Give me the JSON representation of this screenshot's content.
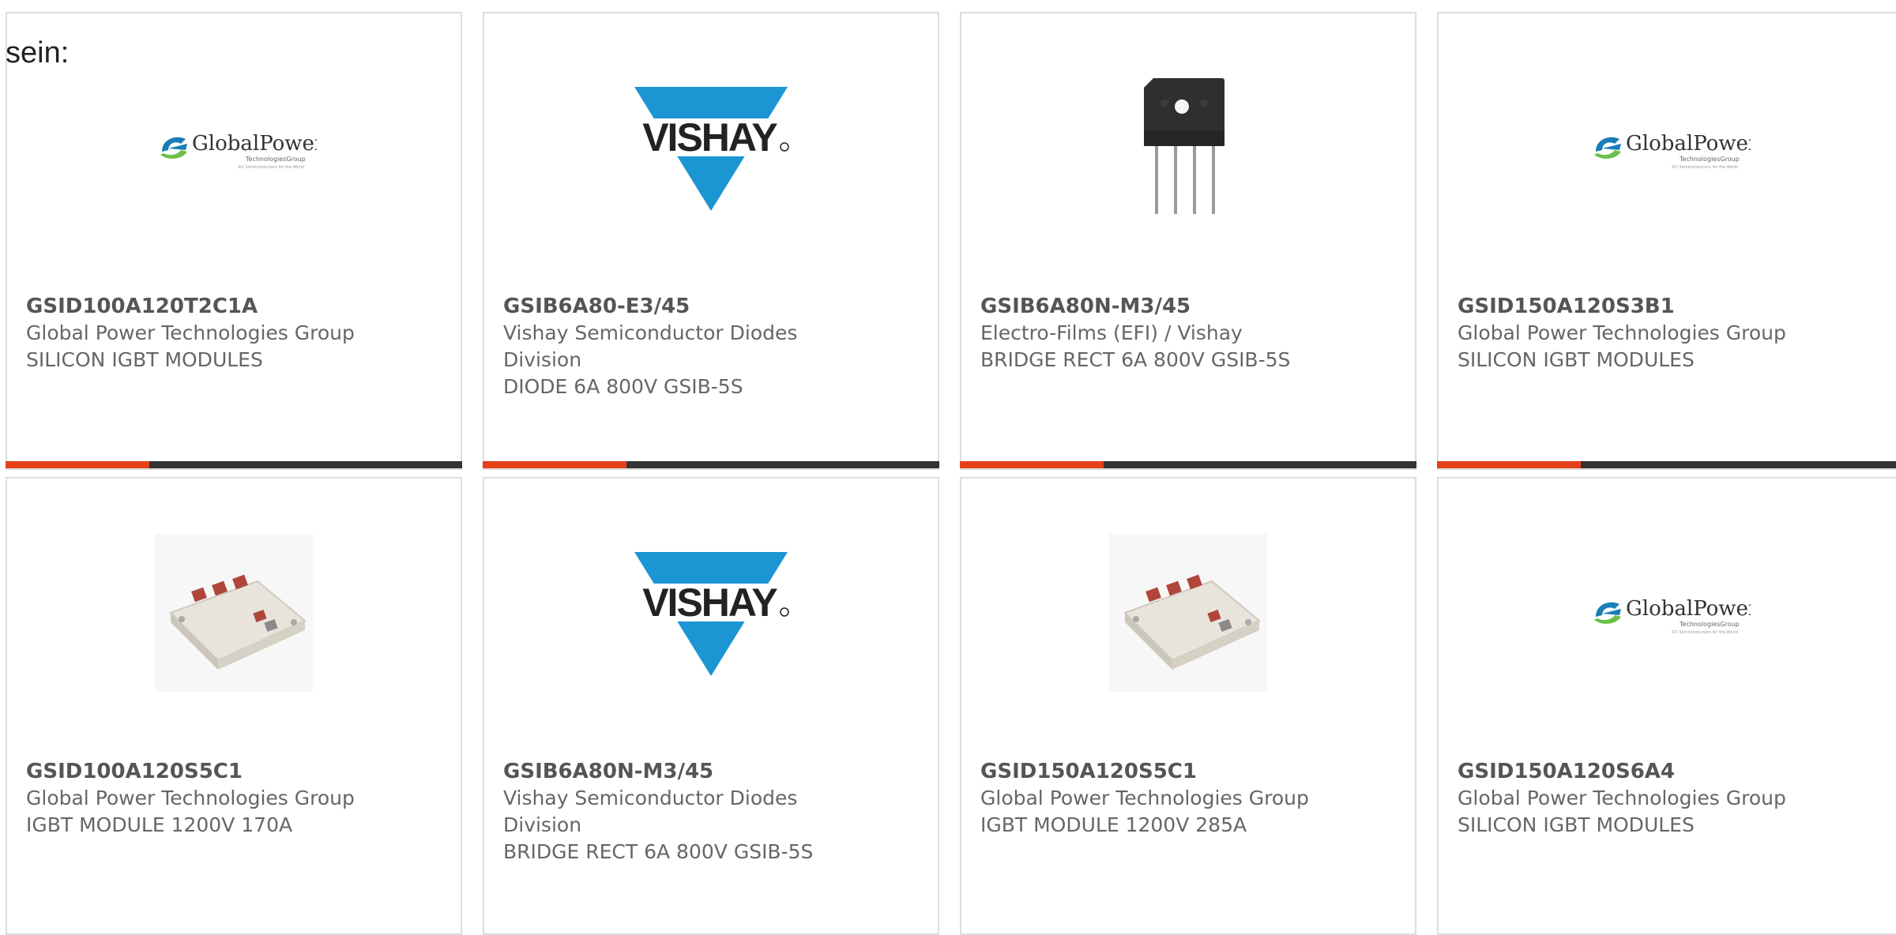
{
  "intro_text": "sein:",
  "colors": {
    "accent_bar": "#e4411b",
    "dark_bar": "#333333",
    "vishay_blue": "#1c95d3",
    "globalpower_blue": "#1a7db8",
    "globalpower_green": "#6cc04a"
  },
  "logos": {
    "vishay": "VISHAY",
    "globalpower_name": "GlobalPower",
    "globalpower_sub": "TechnologiesGroup",
    "globalpower_tag": "SiC Semiconductors for the World"
  },
  "products": [
    {
      "part_number": "GSID100A120T2C1A",
      "manufacturer": "Global Power Technologies Group",
      "description": "SILICON IGBT MODULES",
      "image": "globalpower-logo"
    },
    {
      "part_number": "GSIB6A80-E3/45",
      "manufacturer": "Vishay Semiconductor Diodes Division",
      "description": "DIODE 6A 800V GSIB-5S",
      "image": "vishay-logo"
    },
    {
      "part_number": "GSIB6A80N-M3/45",
      "manufacturer": "Electro-Films (EFI) / Vishay",
      "description": "BRIDGE RECT 6A 800V GSIB-5S",
      "image": "bridge-rectifier-photo"
    },
    {
      "part_number": "GSID150A120S3B1",
      "manufacturer": "Global Power Technologies Group",
      "description": "SILICON IGBT MODULES",
      "image": "globalpower-logo"
    },
    {
      "part_number": "GSID100A120S5C1",
      "manufacturer": "Global Power Technologies Group",
      "description": "IGBT MODULE 1200V 170A",
      "image": "igbt-module-photo"
    },
    {
      "part_number": "GSIB6A80N-M3/45",
      "manufacturer": "Vishay Semiconductor Diodes Division",
      "description": "BRIDGE RECT 6A 800V GSIB-5S",
      "image": "vishay-logo"
    },
    {
      "part_number": "GSID150A120S5C1",
      "manufacturer": "Global Power Technologies Group",
      "description": "IGBT MODULE 1200V 285A",
      "image": "igbt-module-photo"
    },
    {
      "part_number": "GSID150A120S6A4",
      "manufacturer": "Global Power Technologies Group",
      "description": "SILICON IGBT MODULES",
      "image": "globalpower-logo"
    }
  ]
}
